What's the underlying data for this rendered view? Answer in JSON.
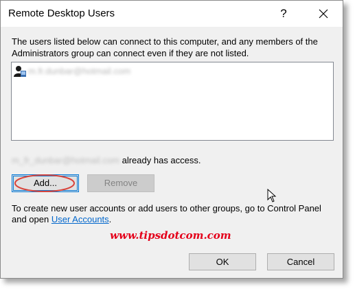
{
  "window": {
    "title": "Remote Desktop Users",
    "help_label": "?"
  },
  "description": "The users listed below can connect to this computer, and any members of the Administrators group can connect even if they are not listed.",
  "user_list": {
    "items": [
      {
        "name": "m.fr.dunbar@hotmail.com",
        "icon": "user-icon",
        "redacted": true
      }
    ]
  },
  "access": {
    "user": "m_fr_dunbar@hotmail.com",
    "suffix": "already has access."
  },
  "buttons": {
    "add": "Add...",
    "remove": "Remove",
    "ok": "OK",
    "cancel": "Cancel"
  },
  "info": {
    "text": "To create new user accounts or add users to other groups, go to Control Panel and open ",
    "link": "User Accounts",
    "end": "."
  },
  "watermark": "www.tipsdotcom.com",
  "colors": {
    "highlight_ellipse": "#d9443b",
    "watermark": "#e4001b",
    "link": "#0066cc",
    "focus_border": "#0078d7"
  }
}
